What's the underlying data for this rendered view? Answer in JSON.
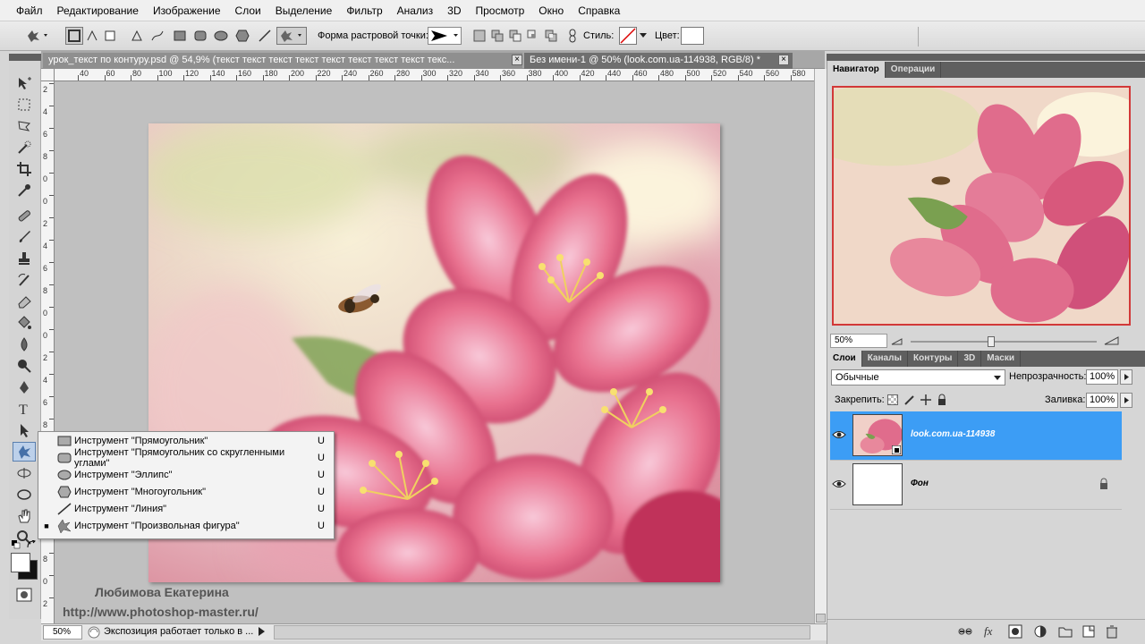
{
  "menu": [
    "Файл",
    "Редактирование",
    "Изображение",
    "Слои",
    "Выделение",
    "Фильтр",
    "Анализ",
    "3D",
    "Просмотр",
    "Окно",
    "Справка"
  ],
  "options": {
    "raster_label": "Форма растровой точки:",
    "style_label": "Стиль:",
    "color_label": "Цвет:"
  },
  "tabs": [
    {
      "label": "урок_текст по контуру.psd @ 54,9% (текст текст текст текст текст текст текст текст текс...",
      "active": false
    },
    {
      "label": "Без имени-1 @ 50% (look.com.ua-114938, RGB/8) *",
      "active": true
    }
  ],
  "ruler": {
    "h": [
      "40",
      "60",
      "80",
      "100",
      "120",
      "140",
      "160",
      "180",
      "200",
      "220",
      "240",
      "260",
      "280",
      "300",
      "320",
      "340",
      "360",
      "380",
      "400",
      "420",
      "440",
      "460",
      "480",
      "500",
      "520",
      "540",
      "560",
      "580"
    ],
    "v": [
      "2",
      "4",
      "6",
      "8",
      "0",
      "0",
      "2",
      "4",
      "6",
      "8",
      "0",
      "0",
      "2",
      "4",
      "6",
      "8",
      "0",
      "0",
      "2",
      "4",
      "6",
      "8",
      "0",
      "2"
    ]
  },
  "flyout": [
    {
      "label": "Инструмент \"Прямоугольник\"",
      "key": "U",
      "icon": "rectangle-icon",
      "selected": false
    },
    {
      "label": "Инструмент \"Прямоугольник со скругленными углами\"",
      "key": "U",
      "icon": "rounded-rectangle-icon",
      "selected": false
    },
    {
      "label": "Инструмент \"Эллипс\"",
      "key": "U",
      "icon": "ellipse-icon",
      "selected": false
    },
    {
      "label": "Инструмент \"Многоугольник\"",
      "key": "U",
      "icon": "polygon-icon",
      "selected": false
    },
    {
      "label": "Инструмент \"Линия\"",
      "key": "U",
      "icon": "line-icon",
      "selected": false
    },
    {
      "label": "Инструмент \"Произвольная фигура\"",
      "key": "U",
      "icon": "custom-shape-icon",
      "selected": true
    }
  ],
  "status": {
    "zoom": "50%",
    "text": "Экспозиция работает только в ..."
  },
  "watermark": {
    "author": "Любимова Екатерина",
    "url": "http://www.photoshop-master.ru/"
  },
  "navigator": {
    "tabs": [
      "Навигатор",
      "Операции"
    ],
    "zoom": "50%"
  },
  "layers": {
    "tabs": [
      "Слои",
      "Каналы",
      "Контуры",
      "3D",
      "Маски"
    ],
    "blend_mode": "Обычные",
    "opacity_label": "Непрозрачность:",
    "opacity": "100%",
    "lock_label": "Закрепить:",
    "fill_label": "Заливка:",
    "fill": "100%",
    "items": [
      {
        "name": "look.com.ua-114938",
        "selected": true
      },
      {
        "name": "Фон",
        "selected": false
      }
    ]
  },
  "colors": {
    "accent": "#3a98f0",
    "selection": "#3c9df5"
  }
}
